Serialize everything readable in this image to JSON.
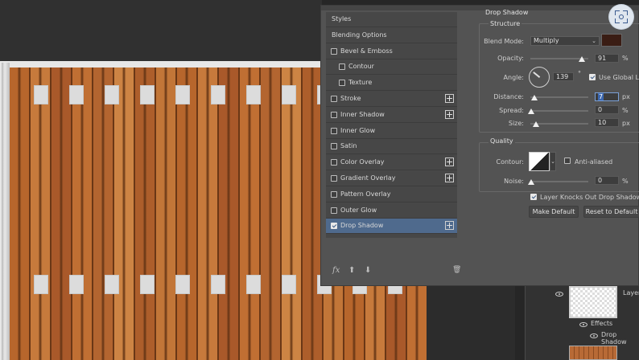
{
  "styles_panel": {
    "items": [
      {
        "label": "Styles",
        "checkbox": false,
        "checked": false,
        "plus": false,
        "indent": 0
      },
      {
        "label": "Blending Options",
        "checkbox": false,
        "checked": false,
        "plus": false,
        "indent": 0
      },
      {
        "label": "Bevel & Emboss",
        "checkbox": true,
        "checked": false,
        "plus": false,
        "indent": 0
      },
      {
        "label": "Contour",
        "checkbox": true,
        "checked": false,
        "plus": false,
        "indent": 1
      },
      {
        "label": "Texture",
        "checkbox": true,
        "checked": false,
        "plus": false,
        "indent": 1
      },
      {
        "label": "Stroke",
        "checkbox": true,
        "checked": false,
        "plus": true,
        "indent": 0
      },
      {
        "label": "Inner Shadow",
        "checkbox": true,
        "checked": false,
        "plus": true,
        "indent": 0
      },
      {
        "label": "Inner Glow",
        "checkbox": true,
        "checked": false,
        "plus": false,
        "indent": 0
      },
      {
        "label": "Satin",
        "checkbox": true,
        "checked": false,
        "plus": false,
        "indent": 0
      },
      {
        "label": "Color Overlay",
        "checkbox": true,
        "checked": false,
        "plus": true,
        "indent": 0
      },
      {
        "label": "Gradient Overlay",
        "checkbox": true,
        "checked": false,
        "plus": true,
        "indent": 0
      },
      {
        "label": "Pattern Overlay",
        "checkbox": true,
        "checked": false,
        "plus": false,
        "indent": 0
      },
      {
        "label": "Outer Glow",
        "checkbox": true,
        "checked": false,
        "plus": false,
        "indent": 0
      },
      {
        "label": "Drop Shadow",
        "checkbox": true,
        "checked": true,
        "plus": true,
        "indent": 0,
        "selected": true
      }
    ],
    "footer": {
      "fx": "fx",
      "up": "⬆",
      "down": "⬇",
      "trash": "🗑"
    }
  },
  "drop_shadow": {
    "title": "Drop Shadow",
    "structure": {
      "title": "Structure",
      "blend_mode_label": "Blend Mode:",
      "blend_mode_value": "Multiply",
      "shadow_color": "#3a1d14",
      "opacity_label": "Opacity:",
      "opacity_value": "91",
      "opacity_level": 0.91,
      "opacity_unit": "%",
      "angle_label": "Angle:",
      "angle_value": "139",
      "angle_unit": "°",
      "use_global_light_label": "Use Global Light",
      "use_global_light_checked": true,
      "distance_label": "Distance:",
      "distance_value": "7",
      "distance_unit": "px",
      "spread_label": "Spread:",
      "spread_value": "0",
      "spread_unit": "%",
      "size_label": "Size:",
      "size_value": "10",
      "size_unit": "px"
    },
    "quality": {
      "title": "Quality",
      "contour_label": "Contour:",
      "anti_aliased_label": "Anti-aliased",
      "anti_aliased_checked": false,
      "noise_label": "Noise:",
      "noise_value": "0",
      "noise_unit": "%"
    },
    "knocks_out_label": "Layer Knocks Out Drop Shadow",
    "knocks_out_checked": true,
    "make_default_label": "Make Default",
    "reset_default_label": "Reset to Default"
  },
  "layers": {
    "layer_name": "Layer",
    "effects_label": "Effects",
    "drop_shadow_label": "Drop Shadow"
  },
  "colors": {
    "accent_selected": "#4f6a8d",
    "fence_wood": "#b8692f"
  }
}
